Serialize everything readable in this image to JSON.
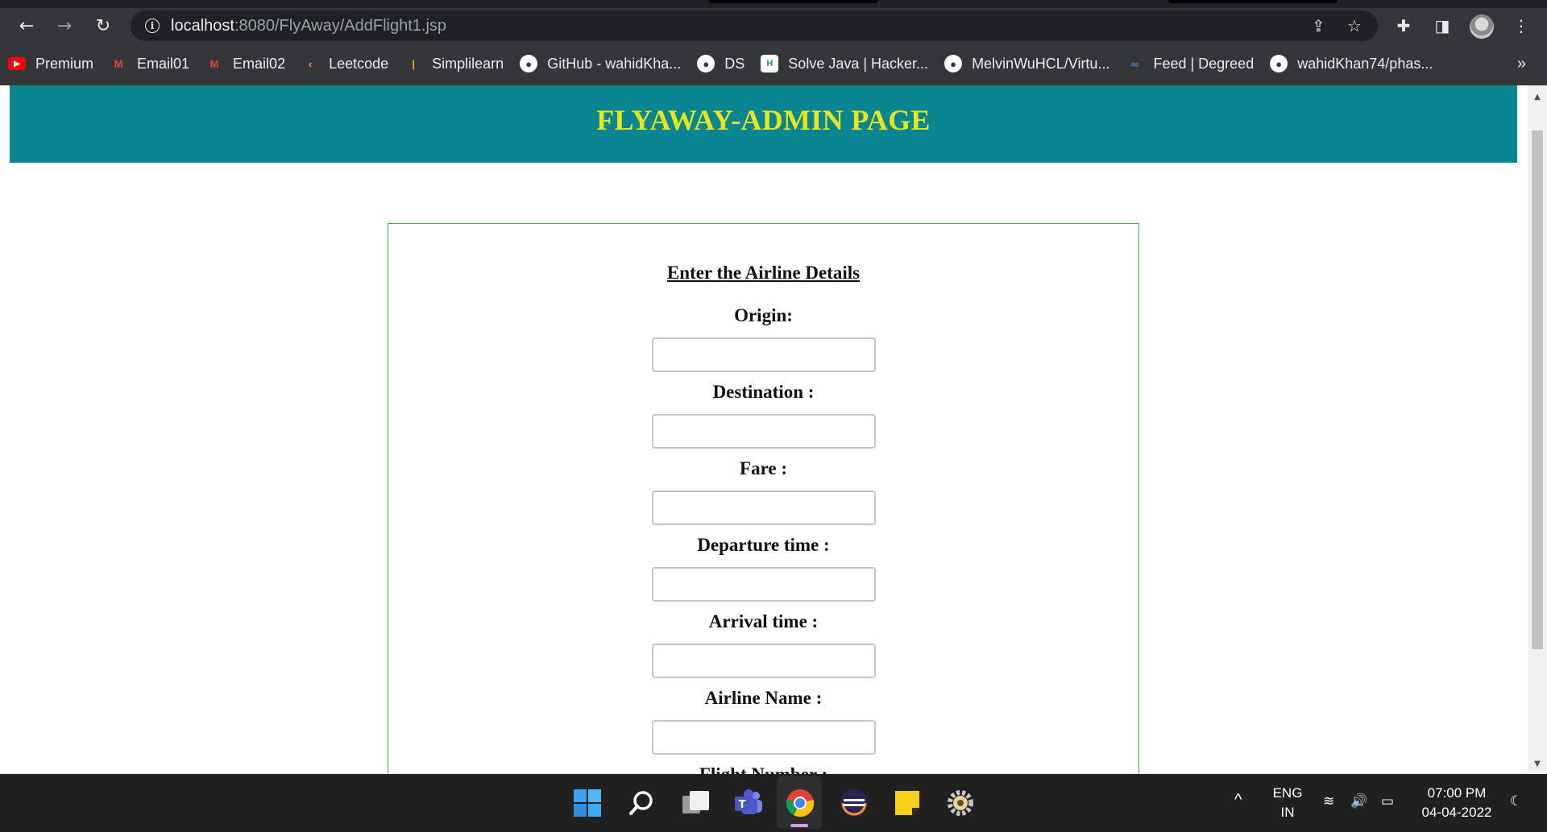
{
  "browser": {
    "url_host": "localhost",
    "url_path": ":8080/FlyAway/AddFlight1.jsp",
    "bookmarks": [
      {
        "label": "Premium",
        "icon": "youtube-icon",
        "color": "#ff0000"
      },
      {
        "label": "Email01",
        "icon": "gmail-icon",
        "color": "#ea4335"
      },
      {
        "label": "Email02",
        "icon": "gmail-icon",
        "color": "#ea4335"
      },
      {
        "label": "Leetcode",
        "icon": "leetcode-icon",
        "color": "#ffa116"
      },
      {
        "label": "Simplilearn",
        "icon": "simplilearn-icon",
        "color": "#f5b400"
      },
      {
        "label": "GitHub - wahidKha...",
        "icon": "github-icon",
        "color": "#ffffff"
      },
      {
        "label": "DS",
        "icon": "github-icon",
        "color": "#ffffff"
      },
      {
        "label": "Solve Java | Hacker...",
        "icon": "hackerrank-icon",
        "color": "#1ba94c"
      },
      {
        "label": "MelvinWuHCL/Virtu...",
        "icon": "github-icon",
        "color": "#ffffff"
      },
      {
        "label": "Feed | Degreed",
        "icon": "degreed-icon",
        "color": "#3f7fe8"
      },
      {
        "label": "wahidKhan74/phas...",
        "icon": "github-icon",
        "color": "#ffffff"
      }
    ],
    "bookmarks_more": "»"
  },
  "page": {
    "header_title": "FLYAWAY-ADMIN PAGE",
    "form_title": "Enter the Airline Details",
    "fields": [
      {
        "label": "Origin:",
        "value": ""
      },
      {
        "label": "Destination :",
        "value": ""
      },
      {
        "label": "Fare :",
        "value": ""
      },
      {
        "label": "Departure time :",
        "value": ""
      },
      {
        "label": "Arrival time :",
        "value": ""
      },
      {
        "label": "Airline Name :",
        "value": ""
      },
      {
        "label": "Flight Number :",
        "value": ""
      }
    ]
  },
  "taskbar": {
    "apps": [
      "windows-start-icon",
      "search-icon",
      "task-view-icon",
      "teams-icon",
      "chrome-icon",
      "eclipse-icon",
      "sticky-notes-icon",
      "settings-icon"
    ],
    "language": "ENG",
    "region": "IN",
    "time": "07:00 PM",
    "date": "04-04-2022"
  },
  "colors": {
    "header_bg": "#0a8592",
    "header_text": "#e6e61a",
    "form_border": "#4caf50"
  }
}
